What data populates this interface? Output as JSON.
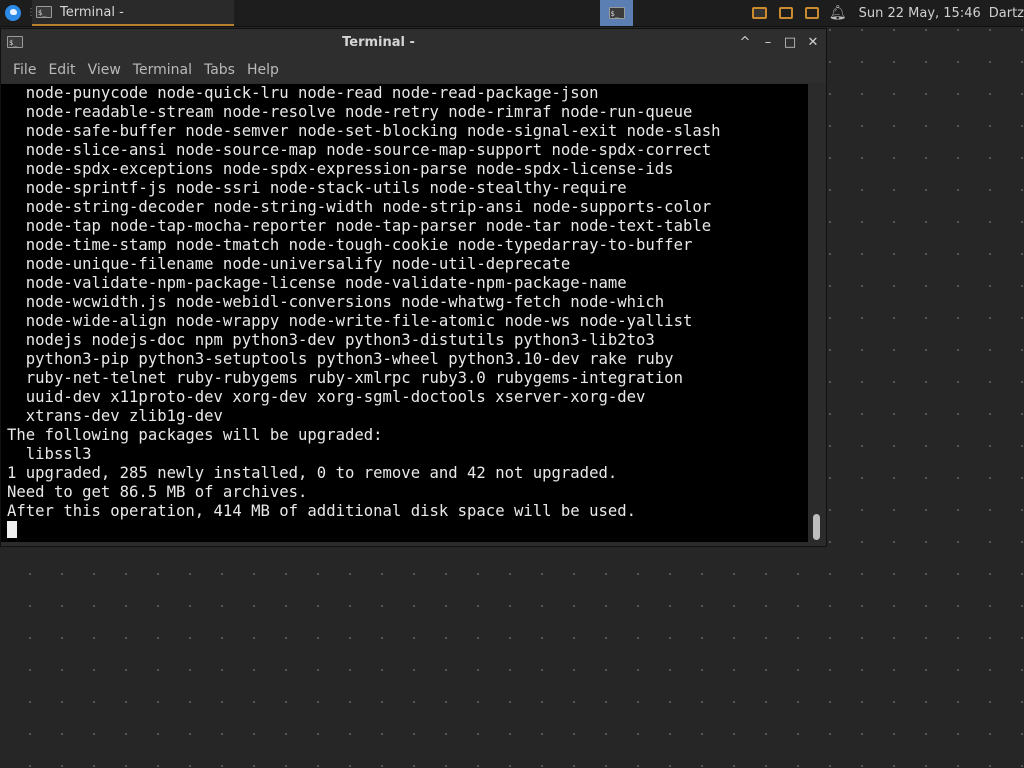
{
  "panel": {
    "taskbar_item": "Terminal -",
    "clock": "Sun 22 May, 15:46",
    "user": "Dartz"
  },
  "window": {
    "title": "Terminal -",
    "buttons": [
      "^",
      "–",
      "□",
      "✕"
    ]
  },
  "menubar": [
    "File",
    "Edit",
    "View",
    "Terminal",
    "Tabs",
    "Help"
  ],
  "terminal_lines": [
    "  node-punycode node-quick-lru node-read node-read-package-json",
    "  node-readable-stream node-resolve node-retry node-rimraf node-run-queue",
    "  node-safe-buffer node-semver node-set-blocking node-signal-exit node-slash",
    "  node-slice-ansi node-source-map node-source-map-support node-spdx-correct",
    "  node-spdx-exceptions node-spdx-expression-parse node-spdx-license-ids",
    "  node-sprintf-js node-ssri node-stack-utils node-stealthy-require",
    "  node-string-decoder node-string-width node-strip-ansi node-supports-color",
    "  node-tap node-tap-mocha-reporter node-tap-parser node-tar node-text-table",
    "  node-time-stamp node-tmatch node-tough-cookie node-typedarray-to-buffer",
    "  node-unique-filename node-universalify node-util-deprecate",
    "  node-validate-npm-package-license node-validate-npm-package-name",
    "  node-wcwidth.js node-webidl-conversions node-whatwg-fetch node-which",
    "  node-wide-align node-wrappy node-write-file-atomic node-ws node-yallist",
    "  nodejs nodejs-doc npm python3-dev python3-distutils python3-lib2to3",
    "  python3-pip python3-setuptools python3-wheel python3.10-dev rake ruby",
    "  ruby-net-telnet ruby-rubygems ruby-xmlrpc ruby3.0 rubygems-integration",
    "  uuid-dev x11proto-dev xorg-dev xorg-sgml-doctools xserver-xorg-dev",
    "  xtrans-dev zlib1g-dev",
    "The following packages will be upgraded:",
    "  libssl3",
    "1 upgraded, 285 newly installed, 0 to remove and 42 not upgraded.",
    "Need to get 86.5 MB of archives.",
    "After this operation, 414 MB of additional disk space will be used."
  ],
  "colors": {
    "desktop": "#262626",
    "terminal_bg": "#000000",
    "terminal_fg": "#e9e9e9",
    "accent": "#c98b2e",
    "workspace_active": "#5b7fb3"
  }
}
